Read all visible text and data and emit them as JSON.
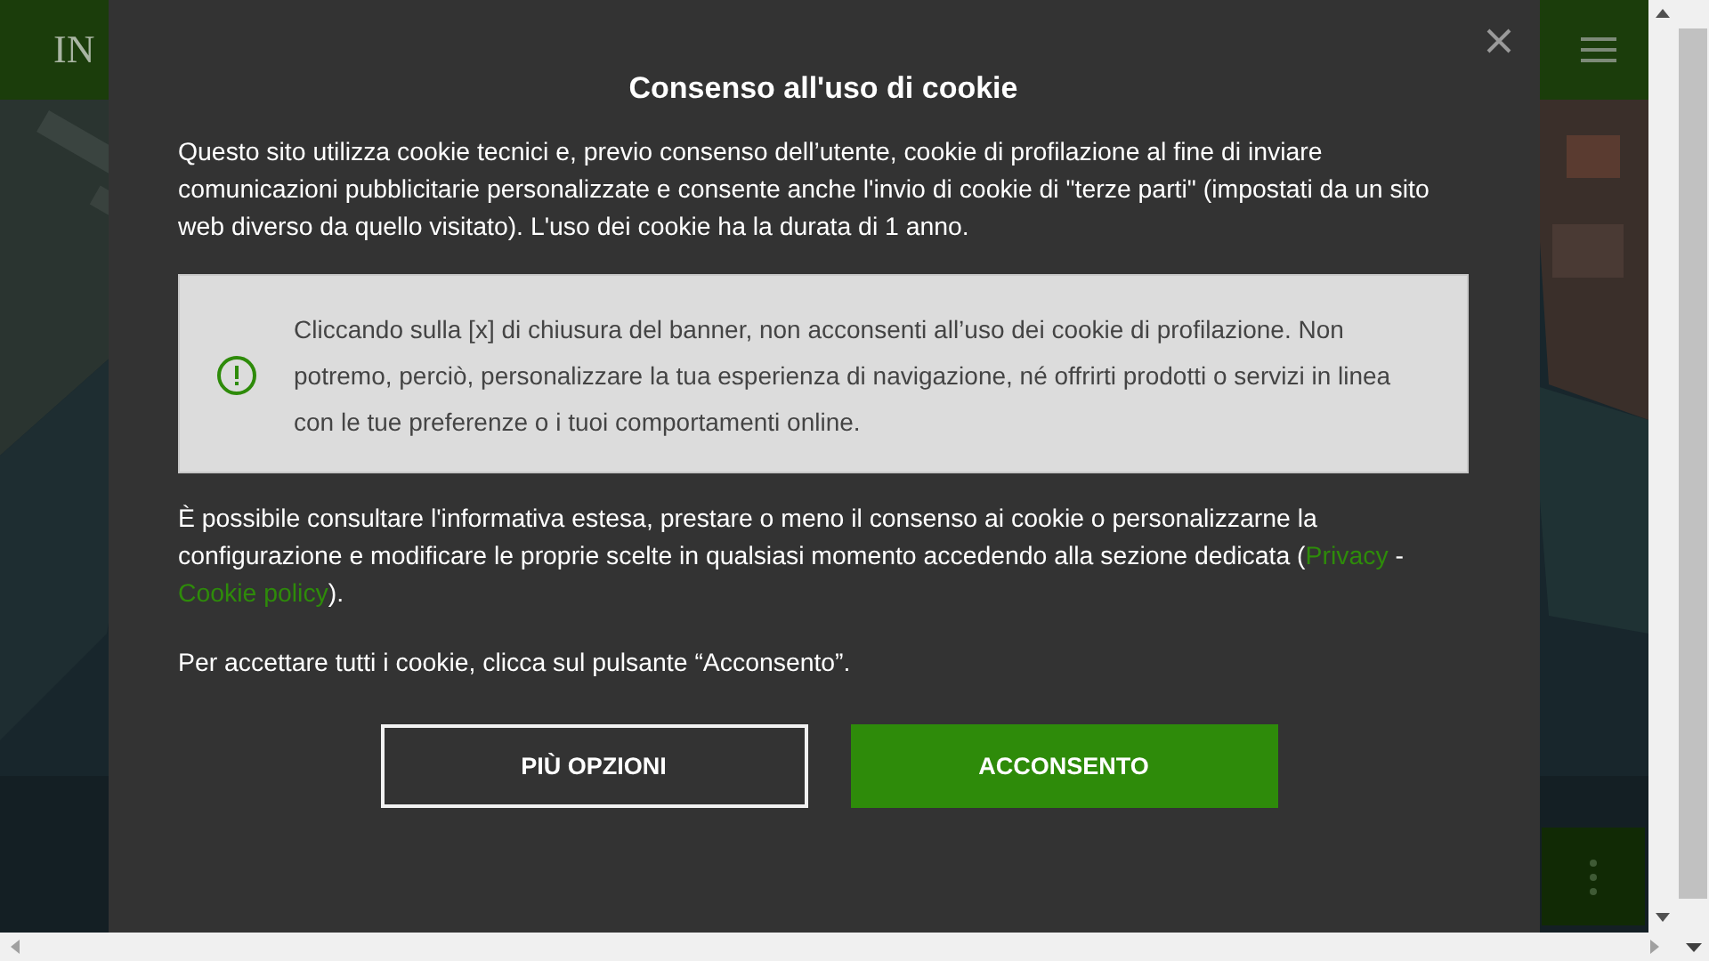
{
  "header": {
    "logo": "IN"
  },
  "cookie_modal": {
    "title": "Consenso all'uso di cookie",
    "intro": "Questo sito utilizza cookie tecnici e, previo consenso dell’utente, cookie di profilazione al fine di inviare comunicazioni pubblicitarie personalizzate e consente anche l'invio di cookie di \"terze parti\" (impostati da un sito web diverso da quello visitato). L'uso dei cookie ha la durata di 1 anno.",
    "notice": "Cliccando sulla [x] di chiusura del banner, non acconsenti all’uso dei cookie di profilazione. Non potremo, perciò, personalizzare la tua esperienza di navigazione, né offrirti prodotti o servizi in linea con le tue preferenze o i tuoi comportamenti online.",
    "info": {
      "text": "È possibile consultare l'informativa estesa, prestare o meno il consenso ai cookie o personalizzarne la configurazione e modificare le proprie scelte in qualsiasi momento accedendo alla sezione dedicata (",
      "links": [
        {
          "label": "Privacy"
        },
        {
          "label": "Cookie policy"
        }
      ],
      "separator": " - ",
      "after": ")."
    },
    "accept_hint": "Per accettare tutti i cookie, clicca sul pulsante “Acconsento”.",
    "buttons": [
      {
        "label": "PIÙ OPZIONI",
        "kind": "outline"
      },
      {
        "label": "ACCONSENTO",
        "kind": "primary"
      }
    ]
  }
}
